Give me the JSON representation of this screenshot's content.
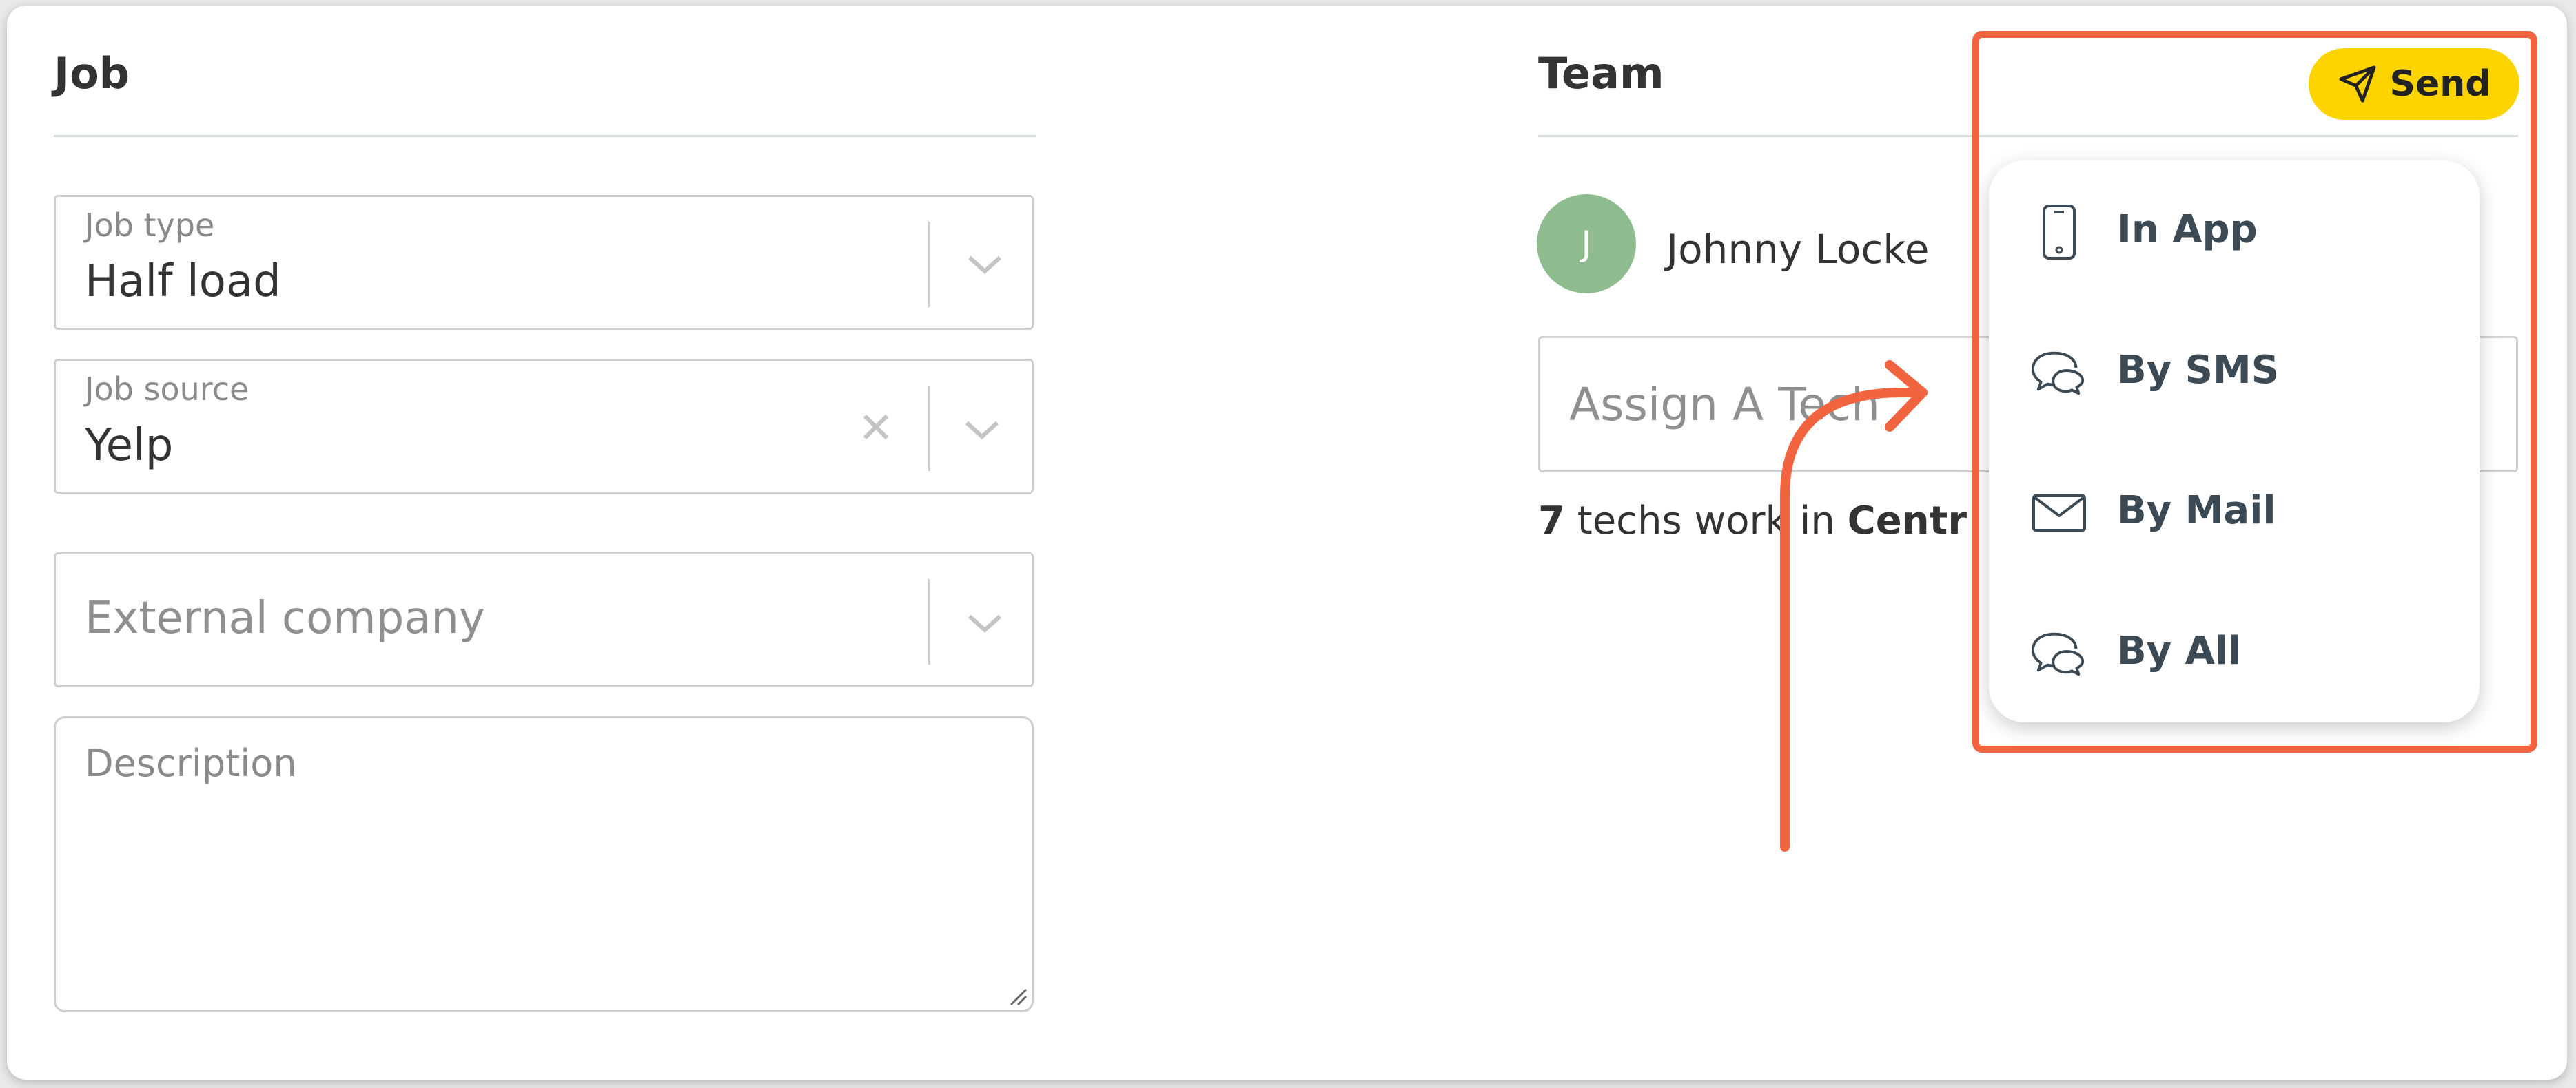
{
  "job": {
    "title": "Job",
    "job_type": {
      "label": "Job type",
      "value": "Half load"
    },
    "job_source": {
      "label": "Job source",
      "value": "Yelp"
    },
    "external_company": {
      "placeholder": "External company"
    },
    "description": {
      "placeholder": "Description"
    }
  },
  "team": {
    "title": "Team",
    "member": {
      "initial": "J",
      "name": "Johnny Locke"
    },
    "assign_placeholder": "Assign A Tech",
    "info": {
      "count": "7",
      "middle": " techs work in ",
      "location": "Centr"
    }
  },
  "send": {
    "label": "Send",
    "menu": [
      {
        "label": "In App",
        "icon": "phone-icon"
      },
      {
        "label": "By SMS",
        "icon": "chat-bubbles-icon"
      },
      {
        "label": "By Mail",
        "icon": "envelope-icon"
      },
      {
        "label": "By All",
        "icon": "chat-bubbles-icon"
      }
    ]
  },
  "colors": {
    "accent_yellow": "#fdd400",
    "annotation": "#f26340",
    "avatar_green": "#8fbc8f"
  }
}
